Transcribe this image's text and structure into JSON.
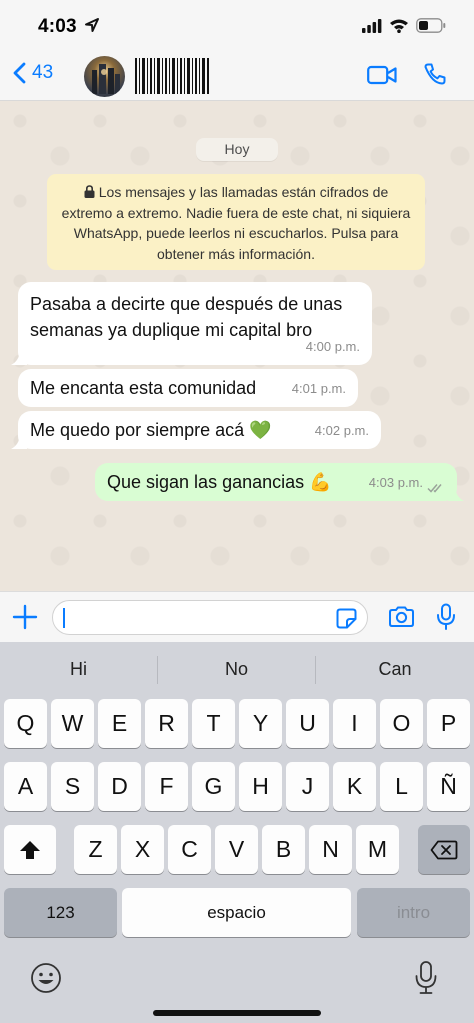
{
  "status_bar": {
    "time": "4:03"
  },
  "header": {
    "back_count": "43",
    "icons": {
      "back": "chevron-left-icon",
      "video": "video-camera-icon",
      "call": "phone-icon"
    },
    "accent_color": "#0a7cff"
  },
  "chat": {
    "date_label": "Hoy",
    "encryption_notice": "Los mensajes y las llamadas están cifrados de extremo a extremo. Nadie fuera de este chat, ni siquiera WhatsApp, puede leerlos ni escucharlos. Pulsa para obtener más información.",
    "messages": [
      {
        "direction": "incoming",
        "text": "Pasaba a decirte que después de unas semanas ya duplique mi capital bro",
        "time": "4:00 p.m."
      },
      {
        "direction": "incoming",
        "text": "Me encanta esta comunidad",
        "time": "4:01 p.m."
      },
      {
        "direction": "incoming",
        "text": "Me quedo por siempre acá 💚",
        "time": "4:02 p.m."
      },
      {
        "direction": "outgoing",
        "text": "Que sigan las ganancias 💪",
        "time": "4:03 p.m.",
        "status": "read"
      }
    ],
    "colors": {
      "incoming": "#ffffff",
      "outgoing": "#d9fdd3",
      "notice": "#fbf1c6"
    }
  },
  "input": {
    "value": "",
    "icons": [
      "plus-icon",
      "sticker-icon",
      "camera-icon",
      "microphone-icon"
    ]
  },
  "keyboard": {
    "suggestions": [
      "Hi",
      "No",
      "Can"
    ],
    "row1": [
      "Q",
      "W",
      "E",
      "R",
      "T",
      "Y",
      "U",
      "I",
      "O",
      "P"
    ],
    "row2": [
      "A",
      "S",
      "D",
      "F",
      "G",
      "H",
      "J",
      "K",
      "L",
      "Ñ"
    ],
    "row3": [
      "Z",
      "X",
      "C",
      "V",
      "B",
      "N",
      "M"
    ],
    "numbers_key": "123",
    "space_key": "espacio",
    "return_key": "intro"
  }
}
